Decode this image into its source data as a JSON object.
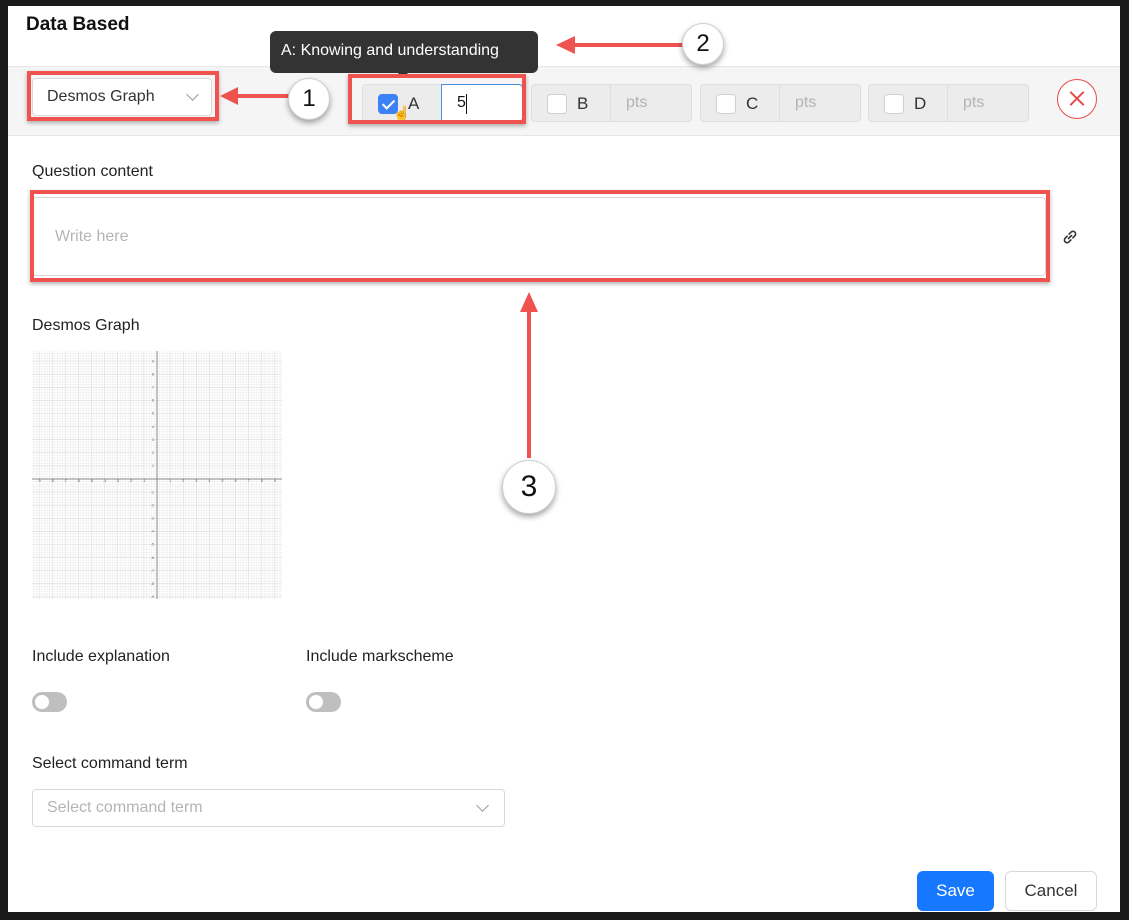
{
  "dialog": {
    "title": "Data Based"
  },
  "toolbar": {
    "type_select": {
      "value": "Desmos Graph"
    },
    "criteria": [
      {
        "letter": "A",
        "checked": true,
        "points": "5"
      },
      {
        "letter": "B",
        "checked": false,
        "placeholder": "pts"
      },
      {
        "letter": "C",
        "checked": false,
        "placeholder": "pts"
      },
      {
        "letter": "D",
        "checked": false,
        "placeholder": "pts"
      }
    ],
    "tooltip": "A: Knowing and understanding"
  },
  "question": {
    "label": "Question content",
    "placeholder": "Write here"
  },
  "graph": {
    "label": "Desmos Graph",
    "x_ticks": [
      "-9",
      "-8",
      "-7",
      "-6",
      "-5",
      "-4",
      "-3",
      "-2",
      "-1",
      "1",
      "2",
      "3",
      "4",
      "5",
      "6",
      "7",
      "8",
      "9"
    ],
    "y_ticks": [
      "9",
      "8",
      "7",
      "6",
      "5",
      "4",
      "3",
      "2",
      "1",
      "-1",
      "-2",
      "-3",
      "-4",
      "-5",
      "-6",
      "-7",
      "-8",
      "-9"
    ]
  },
  "options": {
    "explanation_label": "Include explanation",
    "explanation_on": false,
    "markscheme_label": "Include markscheme",
    "markscheme_on": false
  },
  "command_term": {
    "label": "Select command term",
    "placeholder": "Select command term"
  },
  "buttons": {
    "save": "Save",
    "cancel": "Cancel"
  },
  "annotations": {
    "badges": [
      "1",
      "2",
      "3"
    ],
    "highlight_color": "#ef5350",
    "primary_color": "#1677ff",
    "danger_color": "#e84a4a"
  }
}
